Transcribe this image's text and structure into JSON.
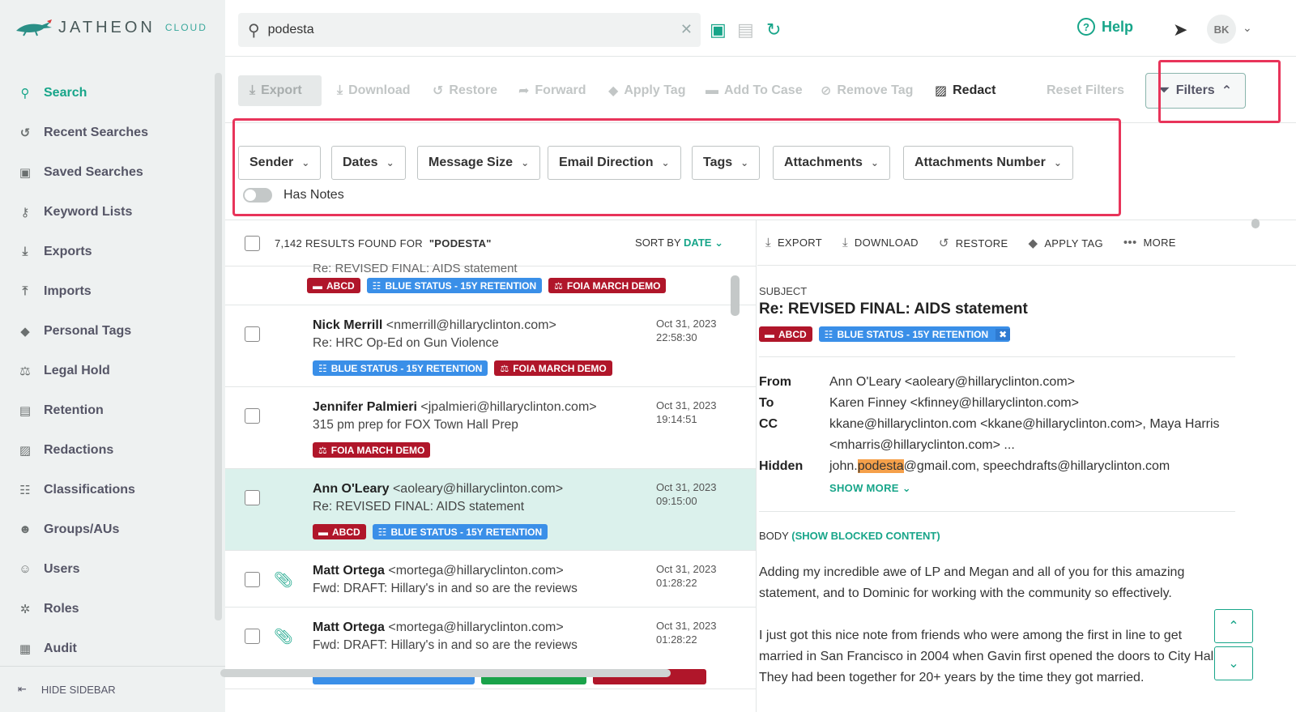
{
  "app": {
    "logo_text": "JATHEON",
    "logo_cloud": "CLOUD"
  },
  "sidebar": {
    "items": [
      {
        "label": "Search",
        "icon": "search-icon"
      },
      {
        "label": "Recent Searches",
        "icon": "history-icon"
      },
      {
        "label": "Saved Searches",
        "icon": "save-icon"
      },
      {
        "label": "Keyword Lists",
        "icon": "key-icon"
      },
      {
        "label": "Exports",
        "icon": "export-icon"
      },
      {
        "label": "Imports",
        "icon": "import-icon"
      },
      {
        "label": "Personal Tags",
        "icon": "tag-icon"
      },
      {
        "label": "Legal Hold",
        "icon": "scales-icon"
      },
      {
        "label": "Retention",
        "icon": "retention-icon"
      },
      {
        "label": "Redactions",
        "icon": "redaction-icon"
      },
      {
        "label": "Classifications",
        "icon": "classification-icon"
      },
      {
        "label": "Groups/AUs",
        "icon": "groups-icon"
      },
      {
        "label": "Users",
        "icon": "users-icon"
      },
      {
        "label": "Roles",
        "icon": "roles-icon"
      },
      {
        "label": "Audit",
        "icon": "audit-icon"
      }
    ],
    "hide_label": "HIDE SIDEBAR"
  },
  "topbar": {
    "search_value": "podesta",
    "help_label": "Help",
    "avatar_initials": "BK"
  },
  "actions": {
    "export": "Export",
    "download": "Download",
    "restore": "Restore",
    "forward": "Forward",
    "apply_tag": "Apply Tag",
    "add_to_case": "Add To Case",
    "remove_tag": "Remove Tag",
    "redact": "Redact",
    "reset_filters": "Reset Filters",
    "filters": "Filters"
  },
  "filters": {
    "buttons": [
      "Sender",
      "Dates",
      "Message Size",
      "Email Direction",
      "Tags",
      "Attachments",
      "Attachments Number"
    ],
    "has_notes": "Has Notes"
  },
  "results": {
    "count_text": "7,142 RESULTS FOUND FOR",
    "query": "\"PODESTA\"",
    "sort_label": "SORT BY",
    "sort_value": "DATE",
    "partial_subject": "Re: REVISED FINAL: AIDS statement",
    "partial_tags": [
      "ABCD",
      "BLUE STATUS - 15Y RETENTION",
      "FOIA MARCH DEMO"
    ],
    "rows": [
      {
        "name": "Nick Merrill",
        "email": "<nmerrill@hillaryclinton.com>",
        "subject": "Re: HRC Op-Ed on Gun Violence",
        "date": "Oct 31, 2023",
        "time": "22:58:30",
        "tags": [
          "BLUE STATUS - 15Y RETENTION",
          "FOIA MARCH DEMO"
        ]
      },
      {
        "name": "Jennifer Palmieri",
        "email": "<jpalmieri@hillaryclinton.com>",
        "subject": "315 pm prep for FOX Town Hall Prep",
        "date": "Oct 31, 2023",
        "time": "19:14:51",
        "tags": [
          "FOIA MARCH DEMO"
        ]
      },
      {
        "name": "Ann O'Leary",
        "email": "<aoleary@hillaryclinton.com>",
        "subject": "Re: REVISED FINAL: AIDS statement",
        "date": "Oct 31, 2023",
        "time": "09:15:00",
        "tags": [
          "ABCD",
          "BLUE STATUS - 15Y RETENTION"
        ]
      },
      {
        "name": "Matt Ortega",
        "email": "<mortega@hillaryclinton.com>",
        "subject": "Fwd: DRAFT: Hillary's in and so are the reviews",
        "date": "Oct 31, 2023",
        "time": "01:28:22",
        "tags": []
      },
      {
        "name": "Matt Ortega",
        "email": "<mortega@hillaryclinton.com>",
        "subject": "Fwd: DRAFT: Hillary's in and so are the reviews",
        "date": "Oct 31, 2023",
        "time": "01:28:22",
        "tags": []
      }
    ]
  },
  "preview": {
    "actions": [
      "EXPORT",
      "DOWNLOAD",
      "RESTORE",
      "APPLY TAG",
      "MORE"
    ],
    "subject_label": "SUBJECT",
    "subject": "Re: REVISED FINAL: AIDS statement",
    "tags": [
      "ABCD",
      "BLUE STATUS - 15Y RETENTION"
    ],
    "from_label": "From",
    "from": "Ann O'Leary <aoleary@hillaryclinton.com>",
    "to_label": "To",
    "to": "Karen Finney <kfinney@hillaryclinton.com>",
    "cc_label": "CC",
    "cc_line1": "kkane@hillaryclinton.com <kkane@hillaryclinton.com>, Maya Harris",
    "cc_line2": "<mharris@hillaryclinton.com> ...",
    "hidden_label": "Hidden",
    "hidden_pre": "john.",
    "hidden_hit": "podesta",
    "hidden_post": "@gmail.com, speechdrafts@hillaryclinton.com",
    "show_more": "SHOW MORE",
    "body_label": "BODY",
    "body_blocked": "(SHOW BLOCKED CONTENT)",
    "body_p1_l1": "Adding my incredible awe of LP and Megan and all of you for this amazing",
    "body_p1_l2": "statement, and to Dominic for working with the community so effectively.",
    "body_p2_l1": "I just got this nice note from friends who were among the first in line to get",
    "body_p2_l2": "married in San Francisco in 2004 when Gavin first opened the doors to City Hall.",
    "body_p2_l3": "They had been together for 20+ years by the time they got married."
  },
  "colors": {
    "accent": "#17a589",
    "highlight_box": "#e8345a",
    "tag_red": "#b0162a",
    "tag_blue": "#3a8fe8",
    "selected_row": "#dbf1ec"
  }
}
